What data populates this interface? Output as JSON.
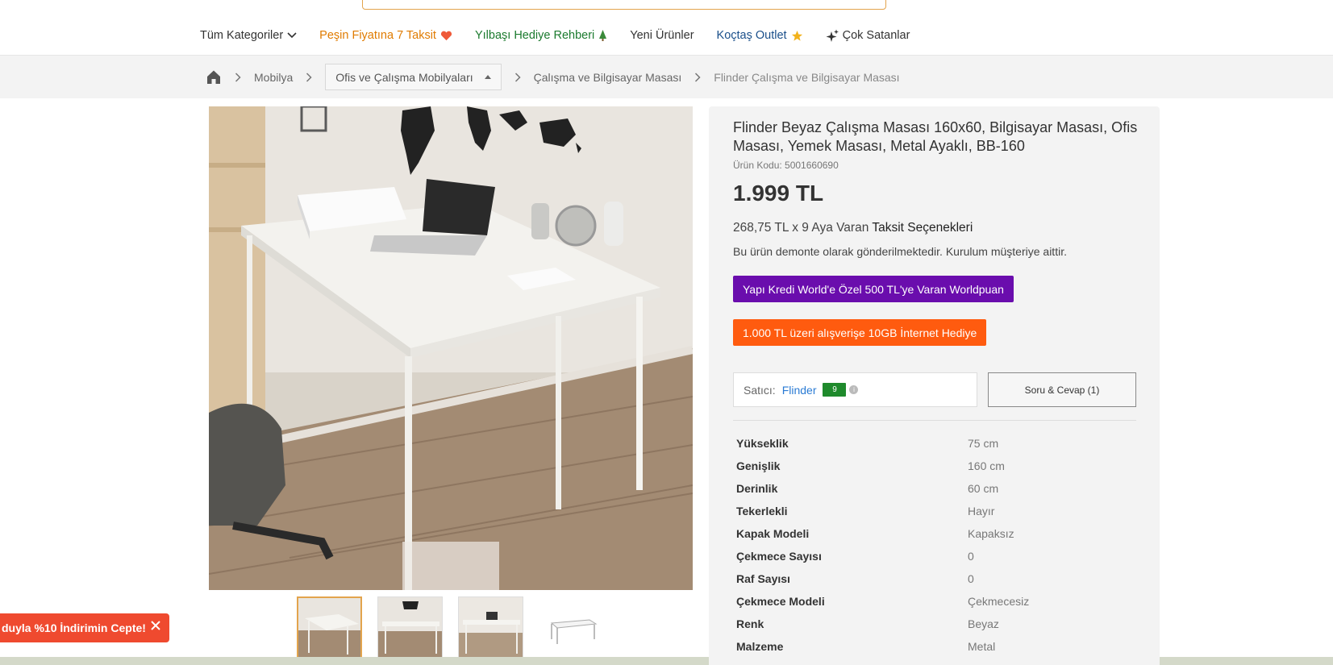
{
  "nav": {
    "all_categories": "Tüm Kategoriler",
    "cash_installment": "Peşin Fiyatına 7 Taksit",
    "new_year_gift": "Yılbaşı Hediye Rehberi",
    "new_products": "Yeni Ürünler",
    "outlet": "Koçtaş Outlet",
    "best_sellers": "Çok Satanlar"
  },
  "breadcrumb": {
    "home_icon": "home-icon",
    "level1": "Mobilya",
    "level2": "Ofis ve Çalışma Mobilyaları",
    "level3": "Çalışma ve Bilgisayar Masası",
    "level4": "Flinder Çalışma ve Bilgisayar Masası"
  },
  "product": {
    "title": "Flinder Beyaz Çalışma Masası 160x60, Bilgisayar Masası, Ofis Masası, Yemek Masası, Metal Ayaklı, BB-160",
    "code": "Ürün Kodu: 5001660690",
    "price": "1.999 TL",
    "installment_prefix": "268,75 TL x 9 Aya Varan",
    "installment_link": "Taksit Seçenekleri",
    "assembly_note": "Bu ürün demonte olarak gönderilmektedir. Kurulum müşteriye aittir.",
    "promo_purple": "Yapı Kredi World'e Özel 500 TL'ye Varan Worldpuan",
    "promo_orange": "1.000 TL üzeri alışverişe 10GB İnternet Hediye"
  },
  "seller": {
    "label": "Satıcı:",
    "name": "Flinder",
    "score": "9"
  },
  "qa_button": "Soru & Cevap (1)",
  "specs": [
    {
      "key": "Yükseklik",
      "value": "75 cm"
    },
    {
      "key": "Genişlik",
      "value": "160 cm"
    },
    {
      "key": "Derinlik",
      "value": "60 cm"
    },
    {
      "key": "Tekerlekli",
      "value": "Hayır"
    },
    {
      "key": "Kapak Modeli",
      "value": "Kapaksız"
    },
    {
      "key": "Çekmece Sayısı",
      "value": "0"
    },
    {
      "key": "Raf Sayısı",
      "value": "0"
    },
    {
      "key": "Çekmece Modeli",
      "value": "Çekmecesiz"
    },
    {
      "key": "Renk",
      "value": "Beyaz"
    },
    {
      "key": "Malzeme",
      "value": "Metal"
    }
  ],
  "toast": {
    "text": "duyla %10 İndirimin Cepte!"
  },
  "colors": {
    "accent_orange": "#e07b00",
    "new_year_green": "#1b7a2e",
    "outlet_blue": "#1a4f8a",
    "promo_purple": "#6a0dad",
    "promo_orange": "#ff5b0f",
    "toast_red": "#ef4a2f"
  }
}
